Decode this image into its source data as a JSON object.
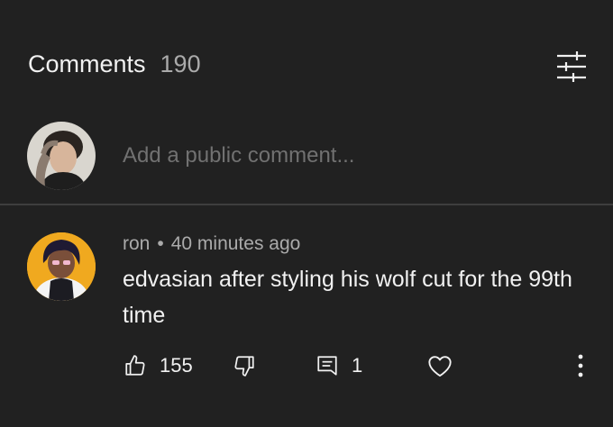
{
  "header": {
    "title": "Comments",
    "count": "190"
  },
  "icons": {
    "sort": "sort-filter-icon",
    "like": "thumbs-up-icon",
    "dislike": "thumbs-down-icon",
    "reply": "reply-comment-icon",
    "heart": "heart-icon",
    "more": "more-vert-icon"
  },
  "composer": {
    "placeholder": "Add a public comment..."
  },
  "comment": {
    "author": "ron",
    "separator": "•",
    "time": "40 minutes ago",
    "text": "edvasian after styling his wolf cut for the 99th time",
    "likes": "155",
    "replies": "1"
  },
  "colors": {
    "background": "#212121",
    "text": "#f1f1f1",
    "secondary": "#aaaaaa",
    "divider": "#3e3e3e",
    "avatar_bg": "#f0a91f"
  }
}
